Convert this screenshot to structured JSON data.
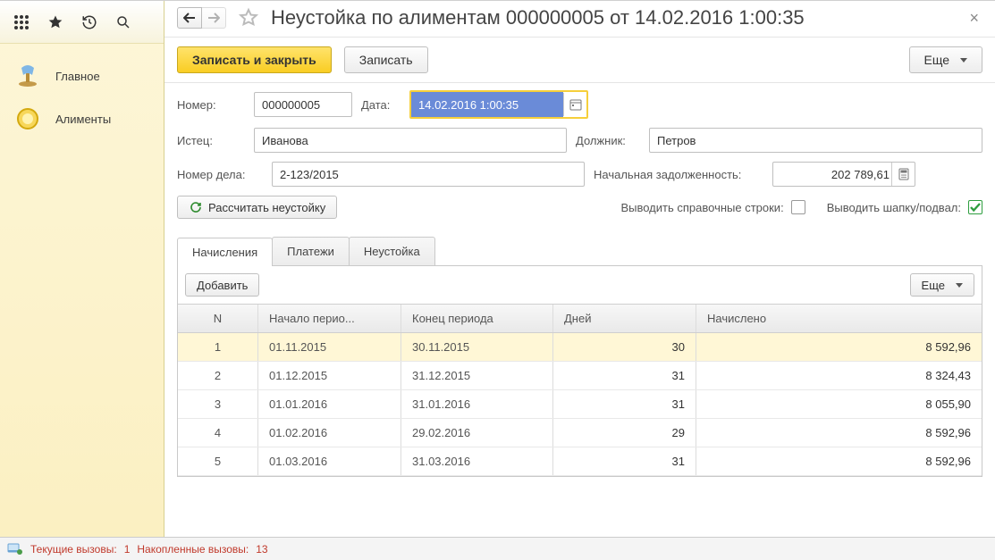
{
  "sidebar": {
    "items": [
      {
        "label": "Главное"
      },
      {
        "label": "Алименты"
      }
    ]
  },
  "title": "Неустойка по алиментам 000000005 от 14.02.2016 1:00:35",
  "toolbar": {
    "save_close": "Записать и закрыть",
    "save": "Записать",
    "more": "Еще"
  },
  "form": {
    "number_label": "Номер:",
    "number_value": "000000005",
    "date_label": "Дата:",
    "date_value": "14.02.2016  1:00:35",
    "plaintiff_label": "Истец:",
    "plaintiff_value": "Иванова",
    "debtor_label": "Должник:",
    "debtor_value": "Петров",
    "case_label": "Номер дела:",
    "case_value": "2-123/2015",
    "debt_label": "Начальная задолженность:",
    "debt_value": "202 789,61",
    "calc_button": "Рассчитать неустойку",
    "opt_ref": "Выводить справочные строки:",
    "opt_head": "Выводить шапку/подвал:"
  },
  "tabs": {
    "t0": "Начисления",
    "t1": "Платежи",
    "t2": "Неустойка",
    "add": "Добавить",
    "more": "Еще"
  },
  "grid": {
    "headers": {
      "n": "N",
      "start": "Начало перио...",
      "end": "Конец периода",
      "days": "Дней",
      "amount": "Начислено"
    },
    "rows": [
      {
        "n": "1",
        "start": "01.11.2015",
        "end": "30.11.2015",
        "days": "30",
        "amount": "8 592,96"
      },
      {
        "n": "2",
        "start": "01.12.2015",
        "end": "31.12.2015",
        "days": "31",
        "amount": "8 324,43"
      },
      {
        "n": "3",
        "start": "01.01.2016",
        "end": "31.01.2016",
        "days": "31",
        "amount": "8 055,90"
      },
      {
        "n": "4",
        "start": "01.02.2016",
        "end": "29.02.2016",
        "days": "29",
        "amount": "8 592,96"
      },
      {
        "n": "5",
        "start": "01.03.2016",
        "end": "31.03.2016",
        "days": "31",
        "amount": "8 592,96"
      }
    ]
  },
  "status": {
    "current_label": "Текущие вызовы:",
    "current_value": "1",
    "accum_label": "Накопленные вызовы:",
    "accum_value": "13"
  }
}
